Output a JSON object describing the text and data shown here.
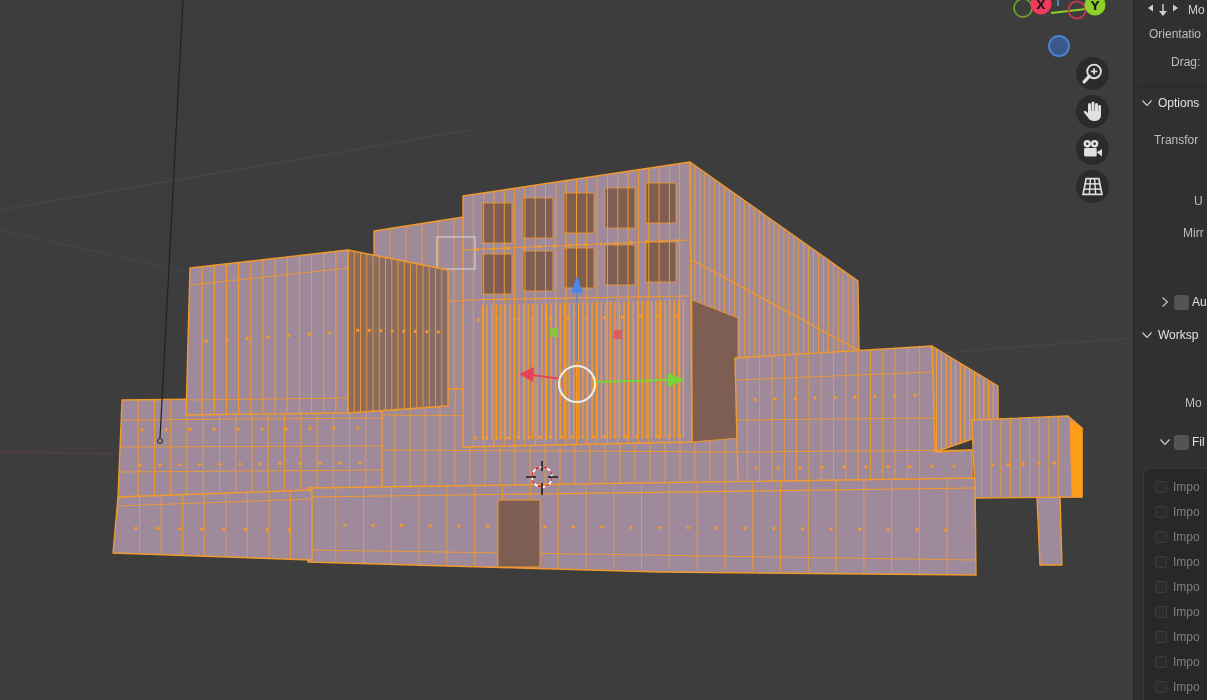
{
  "viewport": {
    "gizmo_axes": [
      {
        "kind": "ring",
        "color": "#6f9a2c"
      },
      {
        "kind": "filled",
        "label": "X",
        "color": "#f2385b"
      },
      {
        "kind": "ring",
        "color": "#c2384f"
      },
      {
        "kind": "filled",
        "label": "Y",
        "color": "#8bd126"
      },
      {
        "kind": "disc",
        "color": "#3a5889"
      }
    ]
  },
  "sidebar": {
    "rows": [
      {
        "kind": "tool",
        "label": "Mo"
      },
      {
        "kind": "property",
        "label": "Orientatio"
      },
      {
        "kind": "property",
        "label": "Drag:"
      },
      {
        "kind": "divider"
      },
      {
        "kind": "header",
        "label": "Options",
        "expanded": true
      },
      {
        "kind": "property",
        "label": "Transfor"
      },
      {
        "kind": "property",
        "label": "U"
      },
      {
        "kind": "property",
        "label": "Mirr"
      },
      {
        "kind": "check_header",
        "label": "Au",
        "expanded": false,
        "checked": false
      },
      {
        "kind": "header",
        "label": "Worksp",
        "expanded": true
      },
      {
        "kind": "property",
        "label": "Mo"
      },
      {
        "kind": "check_header",
        "label": "Fil",
        "expanded": true,
        "checked": false
      }
    ],
    "filter_list": [
      {
        "label": "Impo",
        "checked": false,
        "disabled": true
      },
      {
        "label": "Impo",
        "checked": false,
        "disabled": true
      },
      {
        "label": "Impo",
        "checked": false,
        "disabled": true
      },
      {
        "label": "Impo",
        "checked": false,
        "disabled": true
      },
      {
        "label": "Impo",
        "checked": false,
        "disabled": true
      },
      {
        "label": "Impo",
        "checked": false,
        "disabled": true
      },
      {
        "label": "Impo",
        "checked": false,
        "disabled": true
      },
      {
        "label": "Impo",
        "checked": false,
        "disabled": true
      },
      {
        "label": "Impo",
        "checked": false,
        "disabled": true
      }
    ]
  }
}
